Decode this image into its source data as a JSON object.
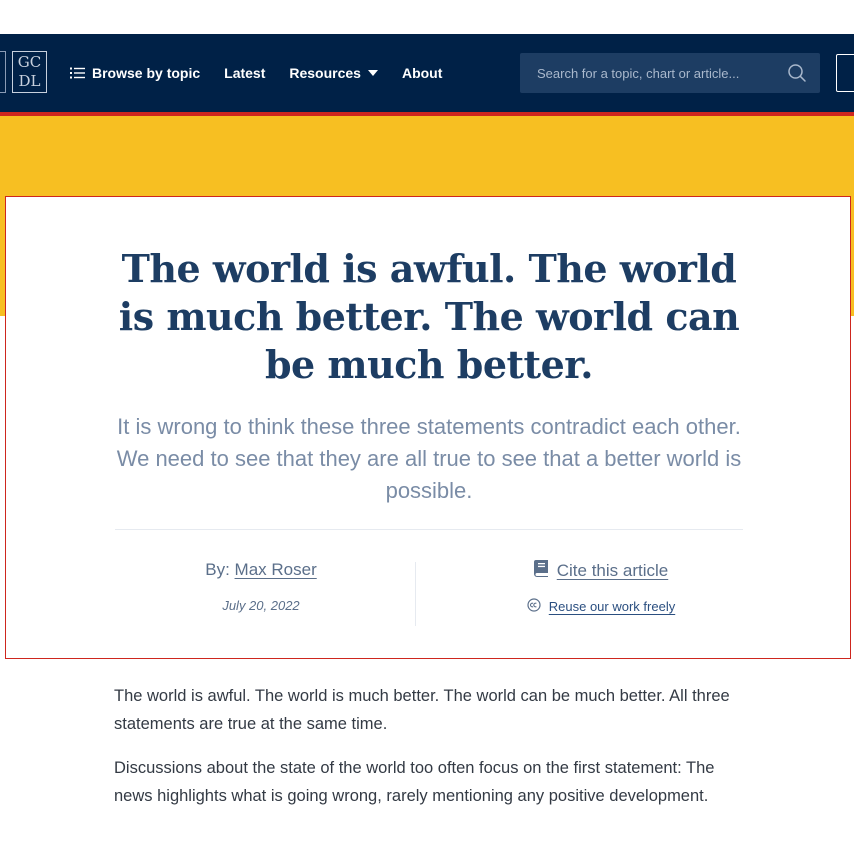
{
  "header": {
    "logo_text": [
      "GC",
      "DL"
    ],
    "nav": {
      "browse_label": "Browse by topic",
      "latest_label": "Latest",
      "resources_label": "Resources",
      "about_label": "About"
    },
    "search": {
      "placeholder": "Search for a topic, chart or article..."
    }
  },
  "article": {
    "title": "The world is awful. The world is much better. The world can be much better.",
    "subtitle": "It is wrong to think these three statements contradict each other. We need to see that they are all true to see that a better world is possible.",
    "byline_prefix": "By:",
    "author": "Max Roser",
    "date": "July 20, 2022",
    "cite_label": "Cite this article",
    "reuse_label": "Reuse our work freely"
  },
  "body": {
    "paragraphs": [
      "The world is awful. The world is much better. The world can be much better. All three statements are true at the same time.",
      "Discussions about the state of the world too often focus on the first statement: The news highlights what is going wrong, rarely mentioning any positive development."
    ]
  },
  "icons": {
    "menu": "list-icon",
    "caret": "caret-down-icon",
    "search": "search-icon",
    "cite": "book-icon",
    "reuse": "creative-commons-icon"
  },
  "colors": {
    "navbar": "#002147",
    "accent": "#ce261e",
    "banner": "#f7bf22",
    "title": "#1d3d63",
    "subtitle": "#7a8ca6"
  }
}
